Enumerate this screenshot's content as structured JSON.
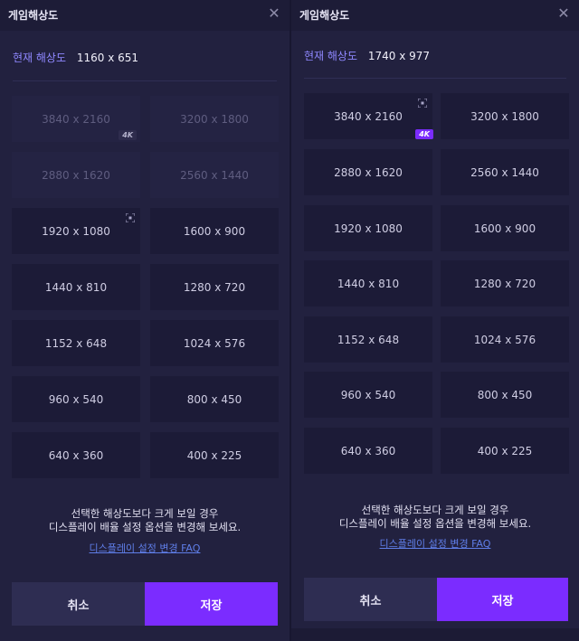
{
  "left": {
    "title": "게임해상도",
    "close_icon": "close-icon",
    "current_label": "현재 해상도",
    "current_value": "1160 x 651",
    "resolutions": [
      "3840 x 2160",
      "3200 x 1800",
      "2880 x 1620",
      "2560 x 1440",
      "1920 x 1080",
      "1600 x 900",
      "1440 x 810",
      "1280 x 720",
      "1152 x 648",
      "1024 x 576",
      "960 x 540",
      "800 x 450",
      "640 x 360",
      "400 x 225"
    ],
    "badge_4k": "4K",
    "notice_line1": "선택한 해상도보다 크게 보일 경우",
    "notice_line2": "디스플레이 배율 설정 옵션을 변경해 보세요.",
    "faq_link": "디스플레이 설정 변경 FAQ",
    "cancel_label": "취소",
    "save_label": "저장"
  },
  "right": {
    "title": "게임해상도",
    "close_icon": "close-icon",
    "current_label": "현재 해상도",
    "current_value": "1740 x 977",
    "resolutions": [
      "3840 x 2160",
      "3200 x 1800",
      "2880 x 1620",
      "2560 x 1440",
      "1920 x 1080",
      "1600 x 900",
      "1440 x 810",
      "1280 x 720",
      "1152 x 648",
      "1024 x 576",
      "960 x 540",
      "800 x 450",
      "640 x 360",
      "400 x 225"
    ],
    "badge_4k": "4K",
    "notice_line1": "선택한 해상도보다 크게 보일 경우",
    "notice_line2": "디스플레이 배율 설정 옵션을 변경해 보세요.",
    "faq_link": "디스플레이 설정 변경 FAQ",
    "cancel_label": "취소",
    "save_label": "저장"
  },
  "colors": {
    "accent": "#7b2cff",
    "current_label": "#8f88ff",
    "link": "#5f7ee8"
  }
}
